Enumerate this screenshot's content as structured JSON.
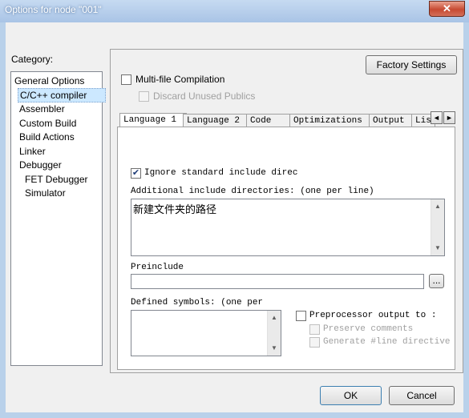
{
  "window": {
    "title": "Options for node \"001\"",
    "close_glyph": "✕"
  },
  "category": {
    "label": "Category:",
    "items": [
      {
        "label": "General Options"
      },
      {
        "label": "C/C++ compiler"
      },
      {
        "label": "Assembler"
      },
      {
        "label": "Custom Build"
      },
      {
        "label": "Build Actions"
      },
      {
        "label": "Linker"
      },
      {
        "label": "Debugger"
      },
      {
        "label": "FET Debugger"
      },
      {
        "label": "Simulator"
      }
    ],
    "selected": "C/C++ compiler"
  },
  "factory_settings": "Factory Settings",
  "multifile": {
    "label": "Multi-file Compilation",
    "checked": false
  },
  "discard": {
    "label": "Discard Unused Publics",
    "checked": false,
    "enabled": false
  },
  "tabs": [
    {
      "label": "Language 1"
    },
    {
      "label": "Language 2"
    },
    {
      "label": "Code"
    },
    {
      "label": "Optimizations"
    },
    {
      "label": "Output"
    },
    {
      "label": "Lis"
    }
  ],
  "tab_arrows": {
    "left": "◄",
    "right": "►"
  },
  "preprocessor_tab": {
    "ignore_std": {
      "label": "Ignore standard include direc",
      "checked": true
    },
    "include_dirs": {
      "label": "Additional include directories: (one per line)",
      "value": "新建文件夹的路径"
    },
    "preinclude": {
      "label": "Preinclude",
      "value": "",
      "browse": "..."
    },
    "defined_symbols": {
      "label": "Defined symbols: (one per",
      "value": ""
    },
    "preproc_output": {
      "label": "Preprocessor output to :",
      "checked": false
    },
    "preserve_comments": {
      "label": "Preserve comments",
      "checked": false,
      "enabled": false
    },
    "generate_line": {
      "label": "Generate #line directive",
      "checked": false,
      "enabled": false
    }
  },
  "buttons": {
    "ok": "OK",
    "cancel": "Cancel"
  },
  "check_glyph": "✔",
  "scroll_up": "▲",
  "scroll_down": "▼"
}
